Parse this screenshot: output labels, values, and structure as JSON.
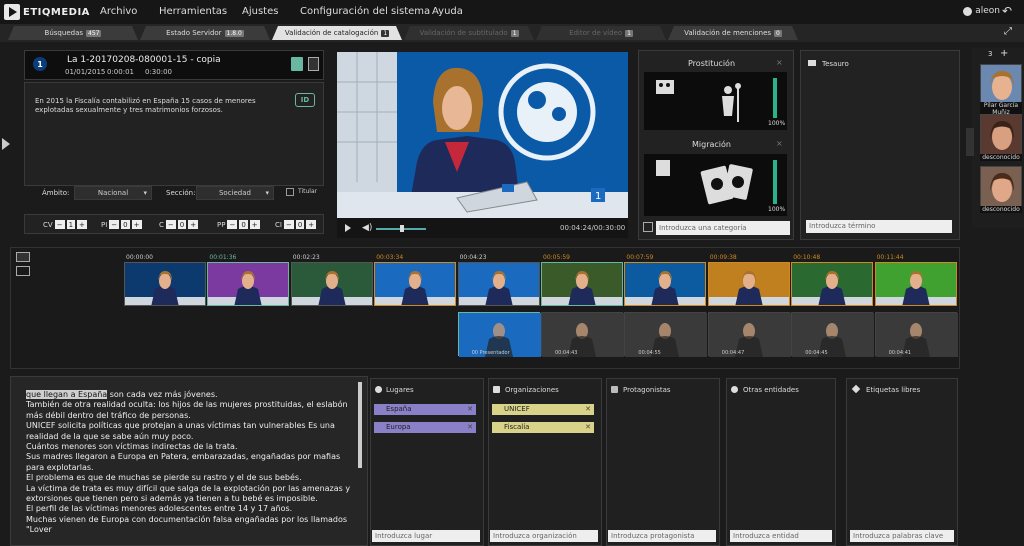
{
  "app": {
    "logo_text": "ETIQMEDIA",
    "user": "aleon"
  },
  "menu": [
    "Archivo",
    "Herramientas",
    "Ajustes",
    "Configuración del sistema",
    "Ayuda"
  ],
  "tabs": [
    {
      "label": "Búsquedas",
      "badge": "457"
    },
    {
      "label": "Estado Servidor",
      "badge": "1.8.0"
    },
    {
      "label": "Validación de catalogación",
      "badge": "1"
    },
    {
      "label": "Validación de subtitulado",
      "badge": "1"
    },
    {
      "label": "Editor de vídeo",
      "badge": "1"
    },
    {
      "label": "Validación de menciones",
      "badge": "0"
    }
  ],
  "clip": {
    "channel": "1",
    "name": "La 1-20170208-080001-15 - copia",
    "date": "01/01/2015",
    "time_start": "0:00:01",
    "time_end": "0:30:00",
    "description": "En 2015 la Fiscalía contabilizó en España 15 casos de menores explotadas sexualmente y tres matrimonios forzosos.",
    "id_badge": "ID"
  },
  "fields": {
    "ambito_label": "Ámbito:",
    "ambito_value": "Nacional",
    "seccion_label": "Sección:",
    "seccion_value": "Sociedad",
    "titular_label": "Titular"
  },
  "counters": [
    {
      "label": "CV",
      "value": "1"
    },
    {
      "label": "PI",
      "value": "0"
    },
    {
      "label": "C",
      "value": "0"
    },
    {
      "label": "PP",
      "value": "0"
    },
    {
      "label": "CI",
      "value": "0"
    }
  ],
  "video": {
    "time": "00:04:24/00:30:00",
    "logo": "1"
  },
  "categories": [
    {
      "name": "Prostitución",
      "pct": "100%"
    },
    {
      "name": "Migración",
      "pct": "100%"
    }
  ],
  "category_placeholder": "Introduzca una categoría",
  "tesauro": {
    "title": "Tesauro",
    "placeholder": "Introduzca término"
  },
  "faces": {
    "count": "3",
    "items": [
      {
        "label": "Pilar García Muñiz"
      },
      {
        "label": "desconocido"
      },
      {
        "label": "desconocido"
      }
    ]
  },
  "timeline": {
    "times": [
      "00:00:00",
      "00:01:36",
      "00:02:23",
      "00:03:34",
      "00:04:23",
      "00:05:59",
      "00:07:59",
      "00:09:38",
      "00:10:48",
      "00:11:44"
    ],
    "sub_labels": [
      "00 Presentador",
      "00:04:43",
      "00:04:55",
      "00:04:47",
      "00:04:45",
      "00:04:41"
    ]
  },
  "transcript": {
    "highlight": "que llegan a España",
    "first_rest": " son cada vez más jóvenes.",
    "lines": [
      "También de otra realidad oculta: los hijos de las mujeres prostituidas, el eslabón más débil dentro del tráfico de personas.",
      "UNICEF solicita políticas que protejan a unas víctimas tan vulnerables Es una realidad de la que se sabe aún muy poco.",
      "Cuántos menores son víctimas indirectas de la trata.",
      "Sus madres llegaron a Europa en Patera, embarazadas, engañadas por mafias para explotarlas.",
      "El problema es que de muchas se pierde su rastro y el de sus bebés.",
      "La víctima de trata es muy difícil que salga de la explotación por las amenazas y extorsiones que tienen pero si además ya tienen a tu bebé es imposible.",
      "El perfil de las víctimas menores adolescentes entre 14 y 17 años.",
      "Muchas vienen de Europa con documentación falsa engañadas por los llamados \"Lover"
    ]
  },
  "entities": [
    {
      "title": "Lugares",
      "tags": [
        "España",
        "Europa"
      ],
      "placeholder": "Introduzca lugar"
    },
    {
      "title": "Organizaciones",
      "tags": [
        "UNICEF",
        "Fiscalía"
      ],
      "placeholder": "Introduzca organización"
    },
    {
      "title": "Protagonistas",
      "tags": [],
      "placeholder": "Introduzca protagonista"
    },
    {
      "title": "Otras entidades",
      "tags": [],
      "placeholder": "Introduzca entidad"
    },
    {
      "title": "Etiquetas libres",
      "tags": [],
      "placeholder": "Introduzca palabras clave"
    }
  ],
  "colors": {
    "accent": "#2ab38a",
    "place_tag": "#8a80c8",
    "org_tag": "#d9d38a",
    "highlight_shot": "#d08a20"
  }
}
